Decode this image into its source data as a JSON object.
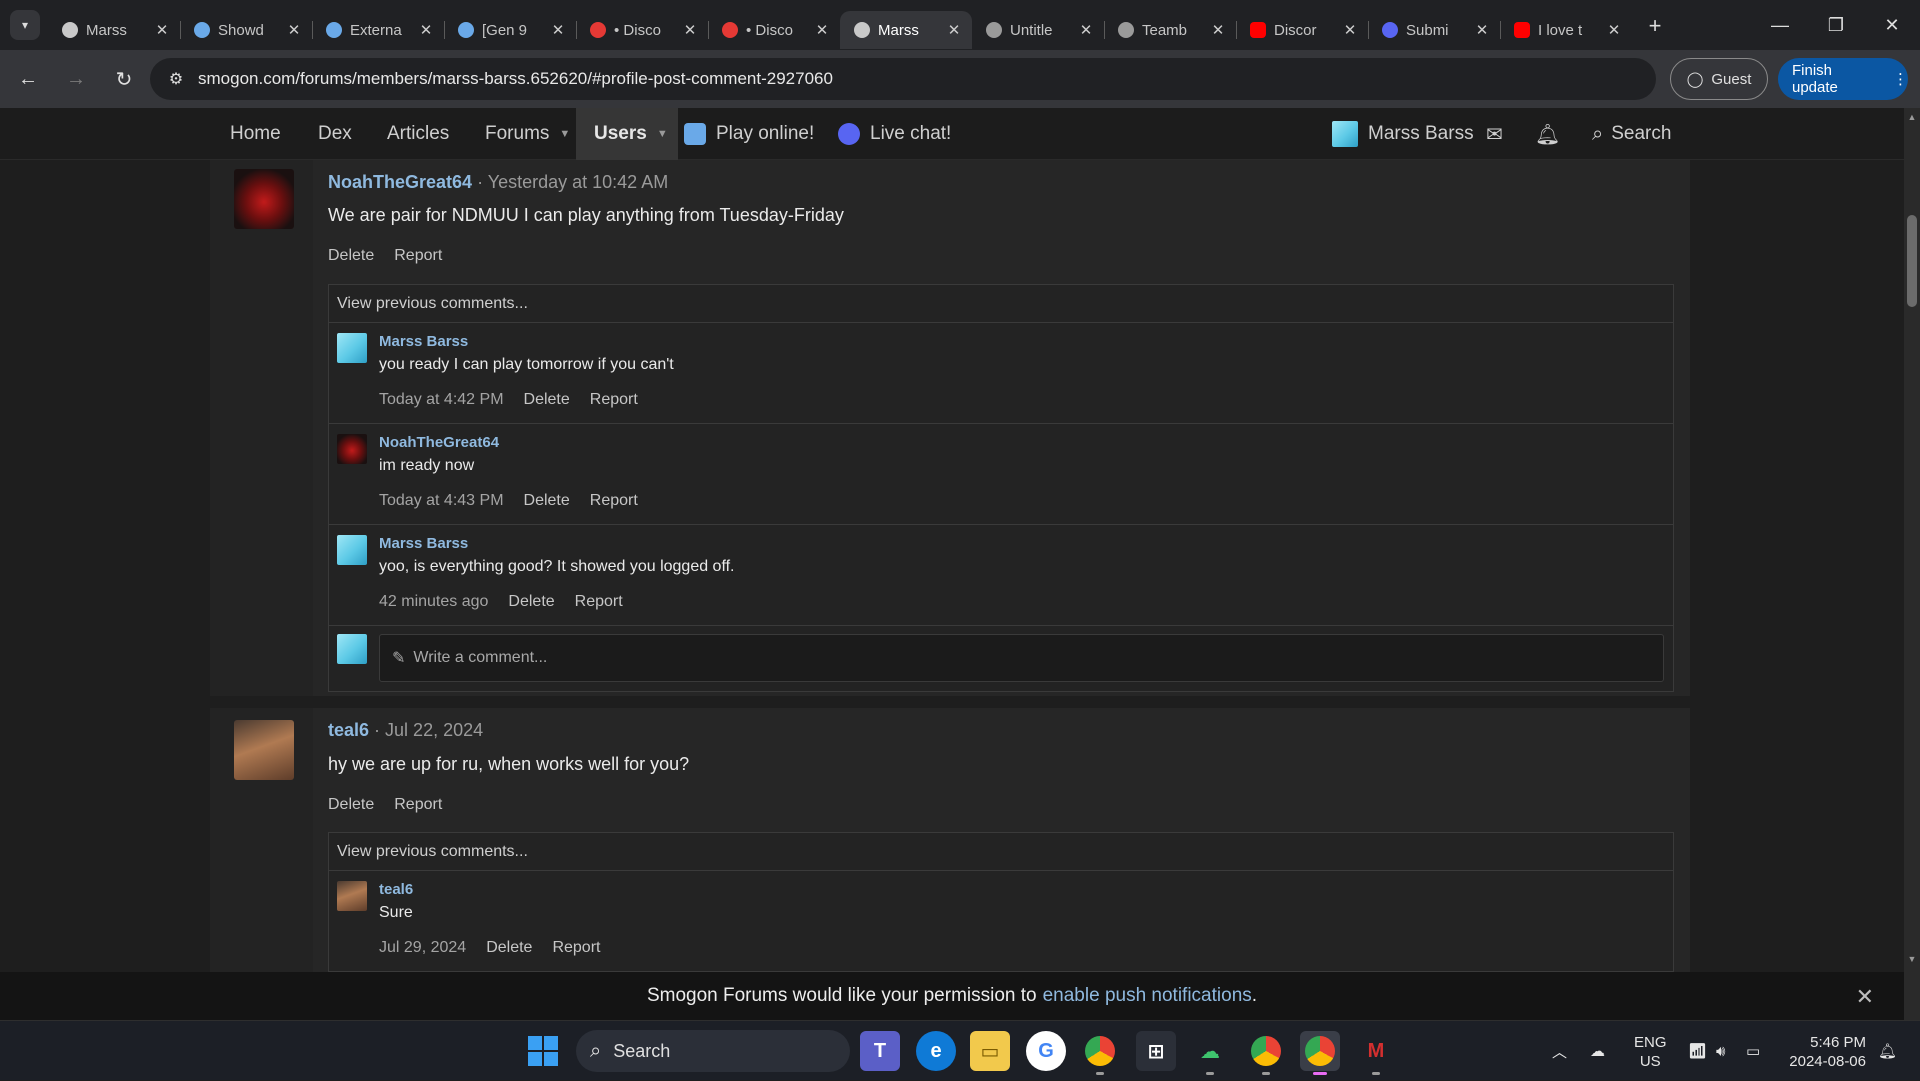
{
  "browser": {
    "tabs": [
      {
        "title": "Marss",
        "icon_color": "#c9c9c9"
      },
      {
        "title": "Showd",
        "icon_color": "#6aa9e8"
      },
      {
        "title": "Externa",
        "icon_color": "#6aa9e8"
      },
      {
        "title": "[Gen 9",
        "icon_color": "#6aa9e8"
      },
      {
        "title": "• Disco",
        "icon_color": "#e53935"
      },
      {
        "title": "• Disco",
        "icon_color": "#e53935"
      },
      {
        "title": "Marss",
        "icon_color": "#c9c9c9",
        "active": true
      },
      {
        "title": "Untitle",
        "icon_color": "#9a9a9a"
      },
      {
        "title": "Teamb",
        "icon_color": "#9a9a9a"
      },
      {
        "title": "Discor",
        "icon_color": "#ff0000"
      },
      {
        "title": "Submi",
        "icon_color": "#5865f2"
      },
      {
        "title": "I love t",
        "icon_color": "#ff0000"
      }
    ],
    "url": "smogon.com/forums/members/marss-barss.652620/#profile-post-comment-2927060",
    "guest_label": "Guest",
    "finish_update_label": "Finish update"
  },
  "site_nav": {
    "items": [
      "Home",
      "Dex",
      "Articles",
      "Forums",
      "Users",
      "Play online!",
      "Live chat!"
    ],
    "account_name": "Marss Barss",
    "search_label": "Search"
  },
  "posts": [
    {
      "author": "NoahTheGreat64",
      "time": "Yesterday at 10:42 AM",
      "body": "We are pair for NDMUU I can play anything from Tuesday-Friday",
      "actions": [
        "Delete",
        "Report"
      ],
      "view_previous": "View previous comments...",
      "comments": [
        {
          "author": "Marss Barss",
          "text": "you ready I can play tomorrow if you can't",
          "time": "Today at 4:42 PM"
        },
        {
          "author": "NoahTheGreat64",
          "text": "im ready now",
          "time": "Today at 4:43 PM"
        },
        {
          "author": "Marss Barss",
          "text": "yoo, is everything good? It showed you logged off.",
          "time": "42 minutes ago"
        }
      ],
      "write_placeholder": "Write a comment..."
    },
    {
      "author": "teal6",
      "time": "Jul 22, 2024",
      "body": "hy we are up for ru, when works well for you?",
      "actions": [
        "Delete",
        "Report"
      ],
      "view_previous": "View previous comments...",
      "comments": [
        {
          "author": "teal6",
          "text": "Sure",
          "time": "Jul 29, 2024"
        }
      ]
    }
  ],
  "comment_actions": [
    "Delete",
    "Report"
  ],
  "push_banner": {
    "text": "Smogon Forums would like your permission to",
    "link": "enable push notifications",
    "suffix": "."
  },
  "taskbar": {
    "search_label": "Search",
    "lang": "ENG",
    "region": "US",
    "time": "5:46 PM",
    "date": "2024-08-06"
  },
  "colors": {
    "accent_link": "#8fb9df",
    "finish_update_bg": "#0b57a3",
    "active_tab_bg": "#35363a"
  }
}
